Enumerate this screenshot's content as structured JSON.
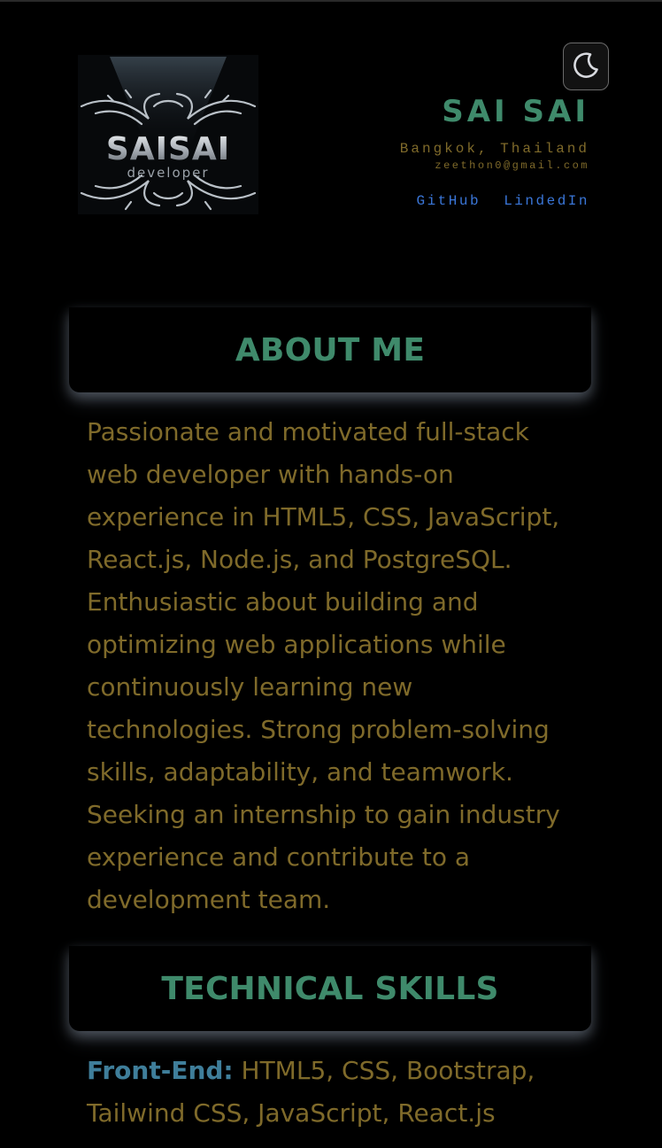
{
  "header": {
    "logo": {
      "main_text": "SAISAI",
      "sub_text": "developer"
    },
    "theme_toggle_icon": "moon-icon",
    "name": "SAI SAI",
    "location": "Bangkok, Thailand",
    "email": "zeethon0@gmail.com",
    "links": [
      {
        "label": "GitHub"
      },
      {
        "label": "LindedIn"
      }
    ]
  },
  "about": {
    "heading": "ABOUT ME",
    "text": "Passionate and motivated full-stack web developer with hands-on experience in HTML5, CSS, JavaScript, React.js, Node.js, and PostgreSQL. Enthusiastic about building and optimizing web applications while continuously learning new technologies. Strong problem-solving skills, adaptability, and teamwork. Seeking an internship to gain industry experience and contribute to a development team."
  },
  "skills": {
    "heading": "TECHNICAL SKILLS",
    "items": [
      {
        "label": "Front-End:",
        "value": " HTML5, CSS, Bootstrap, Tailwind CSS, JavaScript, React.js"
      }
    ]
  },
  "colors": {
    "background": "#000000",
    "accent_green": "#3f8a6b",
    "body_text_olive": "#7f6a2a",
    "link_blue": "#3a76d8",
    "skill_label_blue": "#3f7e9a"
  }
}
